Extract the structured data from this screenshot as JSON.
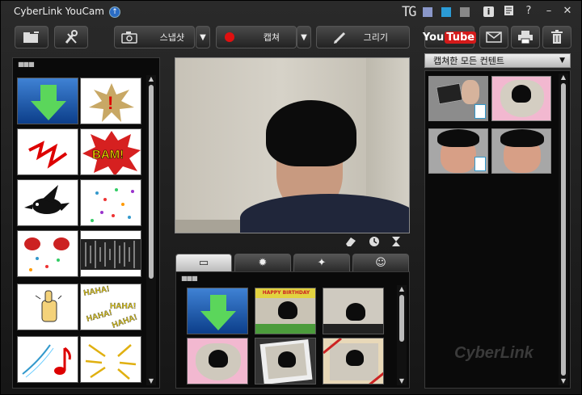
{
  "app": {
    "title": "CyberLink YouCam",
    "tg_label": "TG"
  },
  "colors": {
    "swatch1": "#8a97c9",
    "swatch2": "#2b9bd6",
    "swatch3": "#888888",
    "youtube_red": "#d41a1a",
    "capture_dot": "#e01010"
  },
  "titlebar_icons": [
    "info-icon",
    "feedback-icon",
    "help-icon",
    "minimize-icon",
    "close-icon"
  ],
  "titlebar_glyphs": {
    "info": "i",
    "help": "?",
    "minimize": "–",
    "close": "✕"
  },
  "toolbar": {
    "snapshot_label": "스냅샷",
    "capture_label": "캡쳐",
    "draw_label": "그리기",
    "youtube_you": "You",
    "youtube_tube": "Tube"
  },
  "left_panel": {
    "dots": "■■■",
    "effects": [
      "down-arrow",
      "exclamation-star",
      "red-zigzag",
      "bam-burst",
      "black-bird",
      "falling-confetti",
      "speaker-confetti",
      "sound-waves",
      "thumbs-up",
      "haha-text",
      "musical-note",
      "lightning-lines"
    ],
    "bam_text": "BAM!",
    "haha_text": "HAHA!"
  },
  "center": {
    "tool_icons": [
      "eraser-icon",
      "timer-icon",
      "hourglass-icon"
    ],
    "tab_icons": [
      "frame-icon",
      "monster-icon",
      "magic-wand-icon",
      "smiley-icon"
    ],
    "tab_glyphs": [
      "▭",
      "✹",
      "✦",
      "☺"
    ],
    "dots": "■■■",
    "banner_text": "HAPPY BIRTHDAY"
  },
  "right_panel": {
    "dropdown_label": "캡쳐한 모든 컨텐트",
    "media": [
      "video-thumbnail",
      "photo-heart",
      "video-fisheye",
      "photo-fisheye"
    ]
  },
  "watermark": "CyberLink"
}
